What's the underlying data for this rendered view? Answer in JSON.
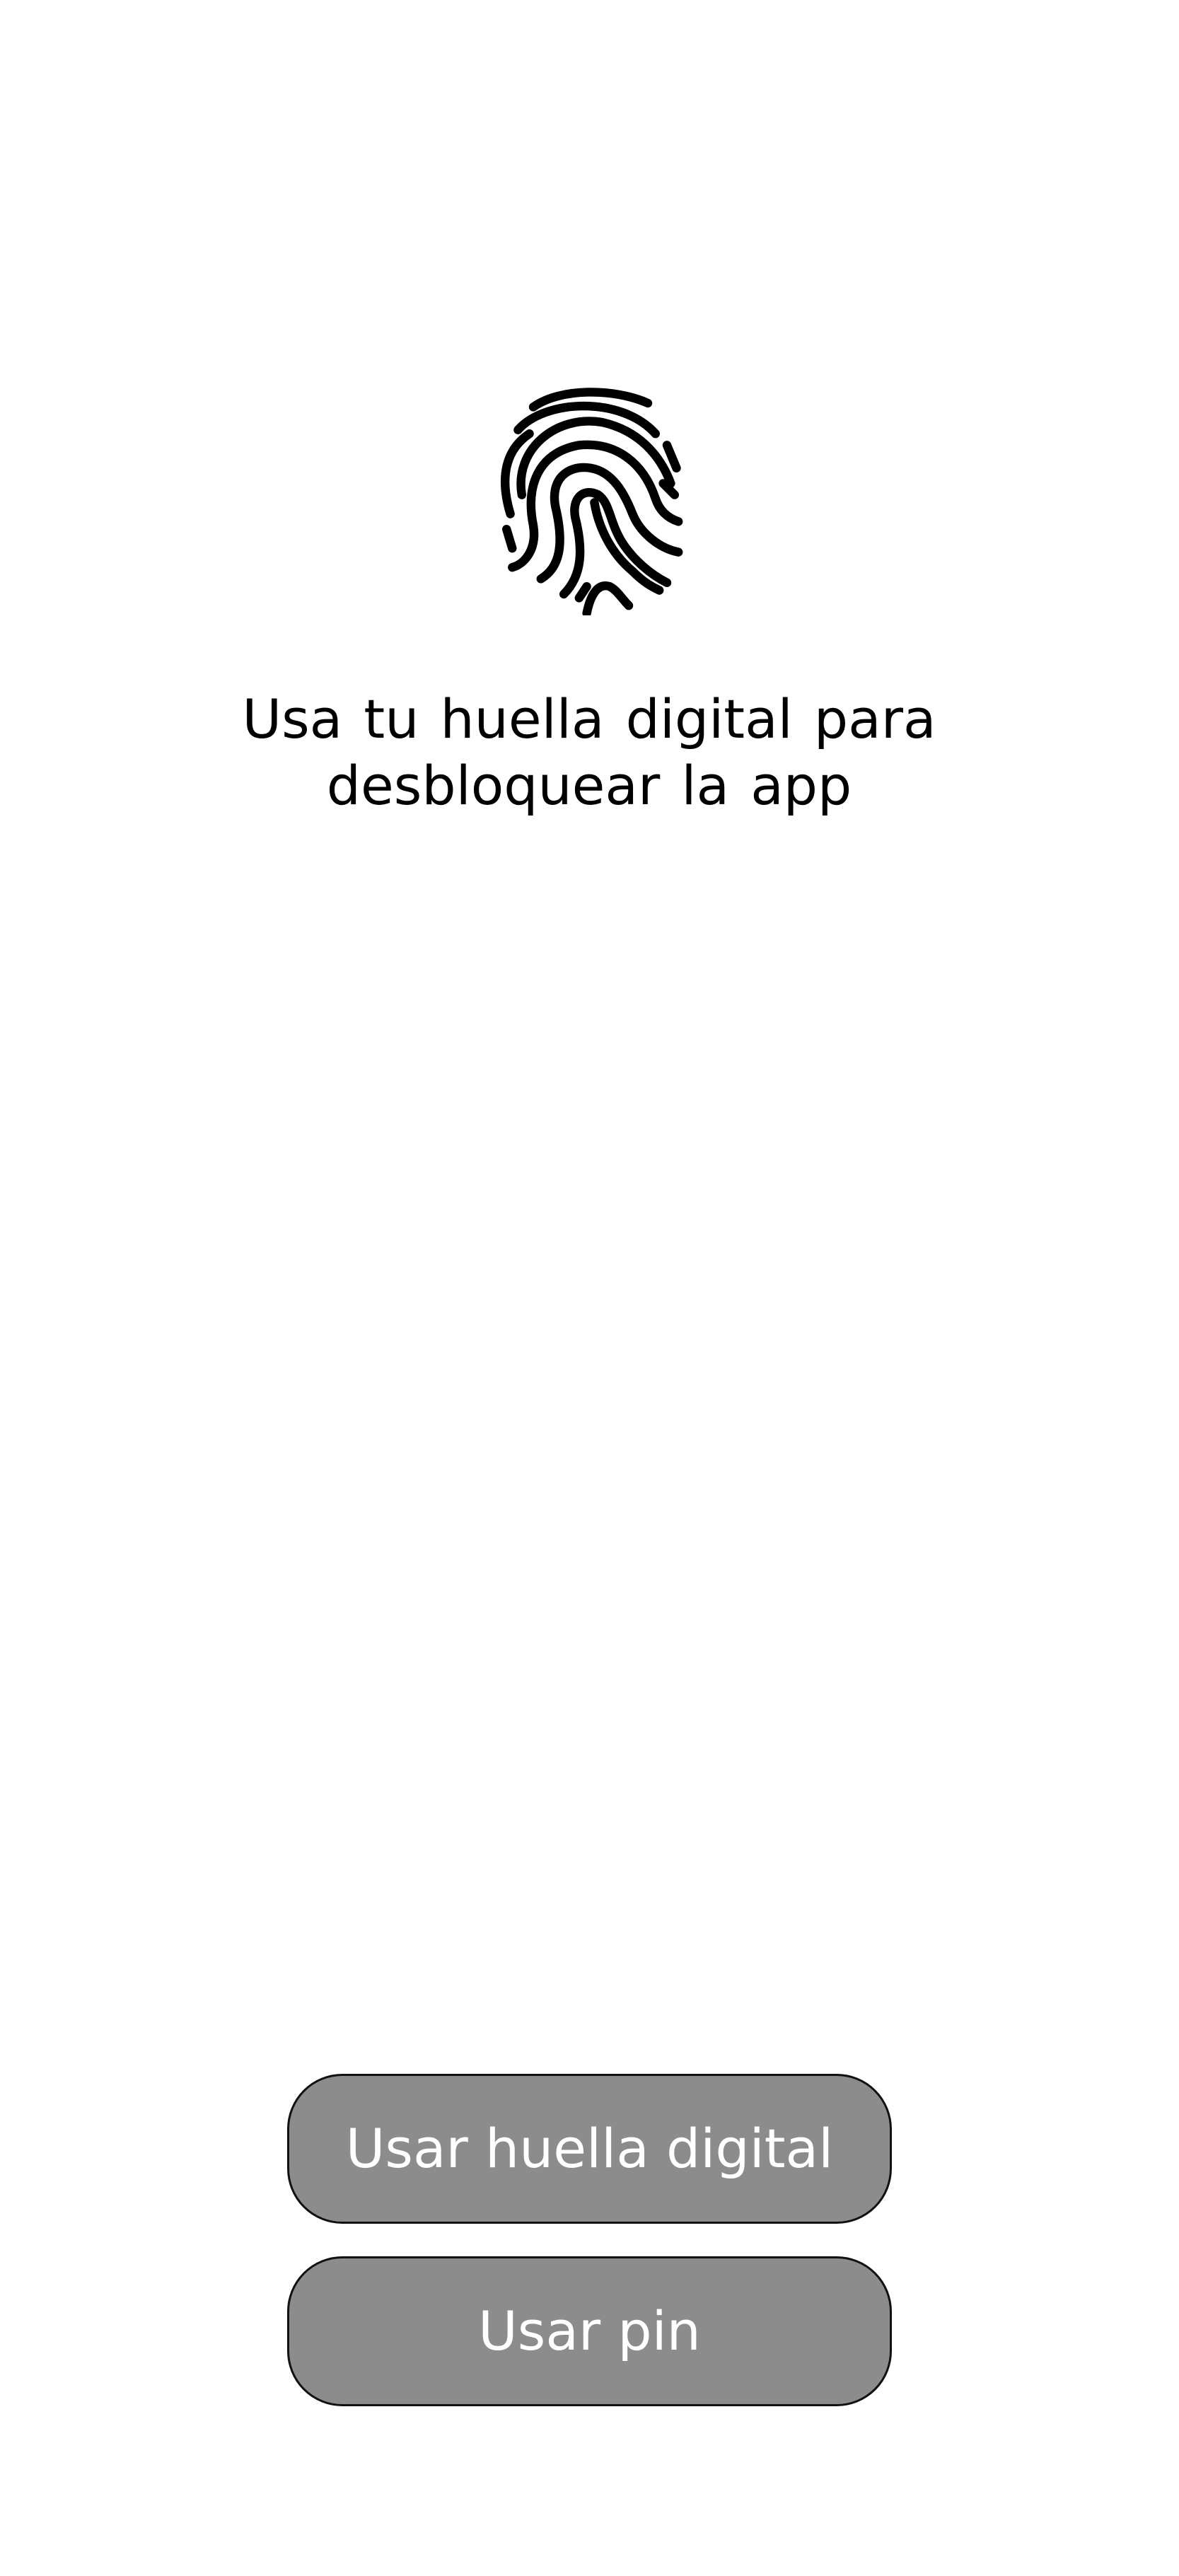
{
  "screen": {
    "background": "#ffffff"
  },
  "auth": {
    "icon": "fingerprint-icon",
    "instruction_line1": "Usa tu huella digital para",
    "instruction_line2": "desbloquear la app"
  },
  "buttons": {
    "fingerprint_label": "Usar huella digital",
    "pin_label": "Usar pin",
    "fill_color": "#8c8c8c",
    "text_color": "#ffffff"
  }
}
